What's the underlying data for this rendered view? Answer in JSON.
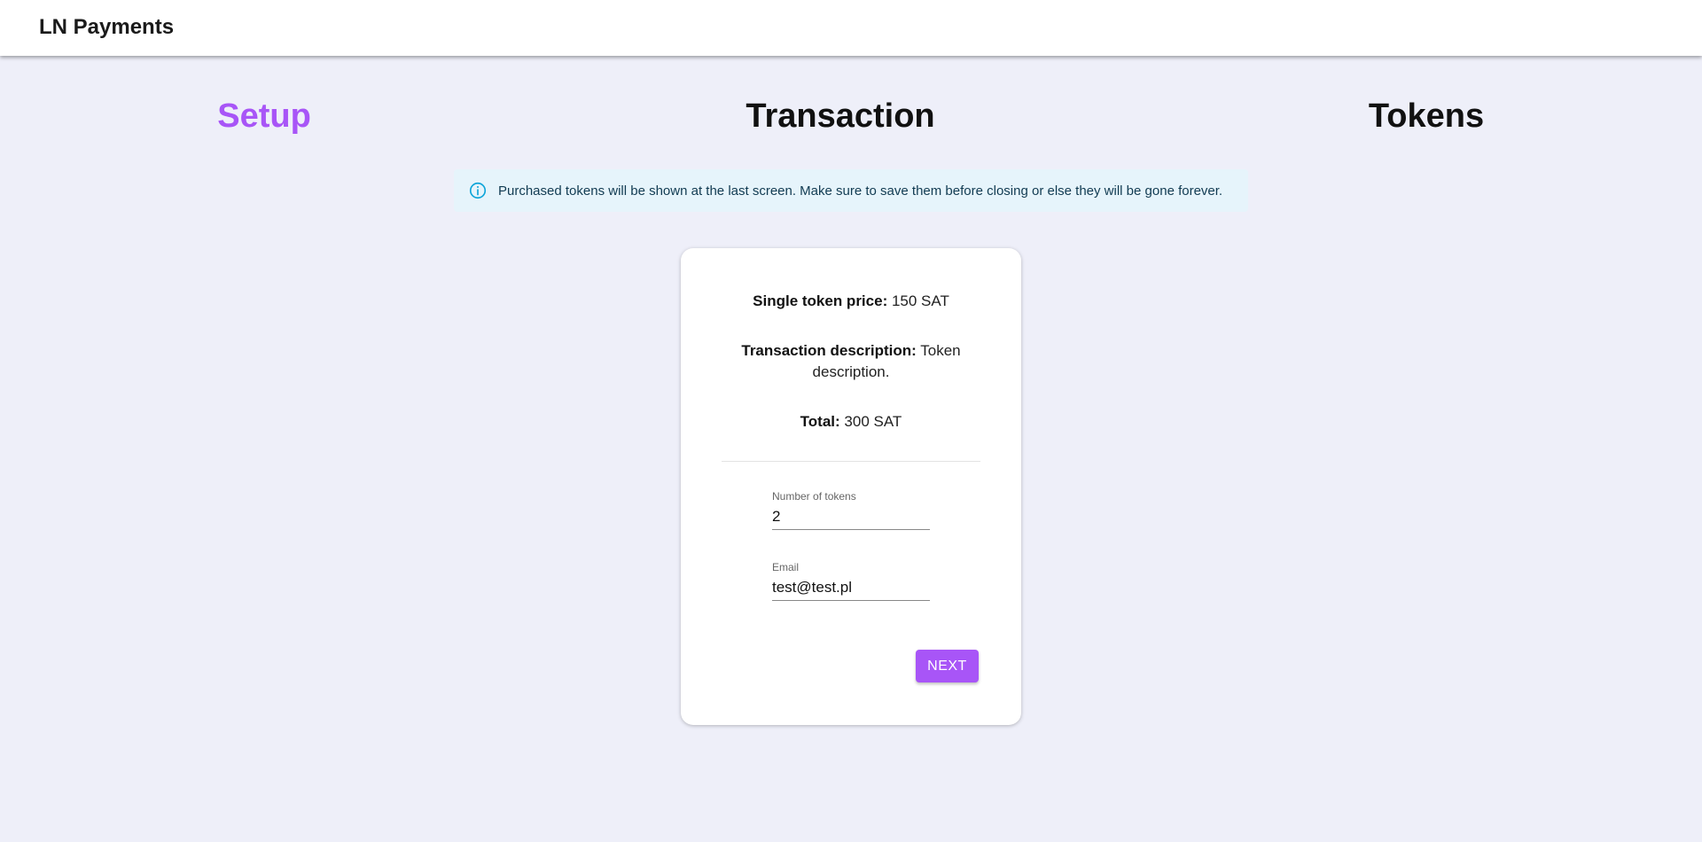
{
  "app": {
    "title": "LN Payments"
  },
  "steps": [
    {
      "label": "Setup",
      "active": true
    },
    {
      "label": "Transaction",
      "active": false
    },
    {
      "label": "Tokens",
      "active": false
    }
  ],
  "alert": {
    "icon": "info-icon",
    "text": "Purchased tokens will be shown at the last screen. Make sure to save them before closing or else they will be gone forever."
  },
  "summary": {
    "price_label": "Single token price:",
    "price_value": "150 SAT",
    "description_label": "Transaction description:",
    "description_value": "Token description.",
    "total_label": "Total:",
    "total_value": "300 SAT"
  },
  "form": {
    "tokens_label": "Number of tokens",
    "tokens_value": "2",
    "email_label": "Email",
    "email_value": "test@test.pl"
  },
  "actions": {
    "next_label": "NEXT"
  },
  "colors": {
    "accent": "#a855f7",
    "background": "#eeeff9",
    "alert_background": "#e6f4fb",
    "alert_icon": "#0ea5d9"
  }
}
